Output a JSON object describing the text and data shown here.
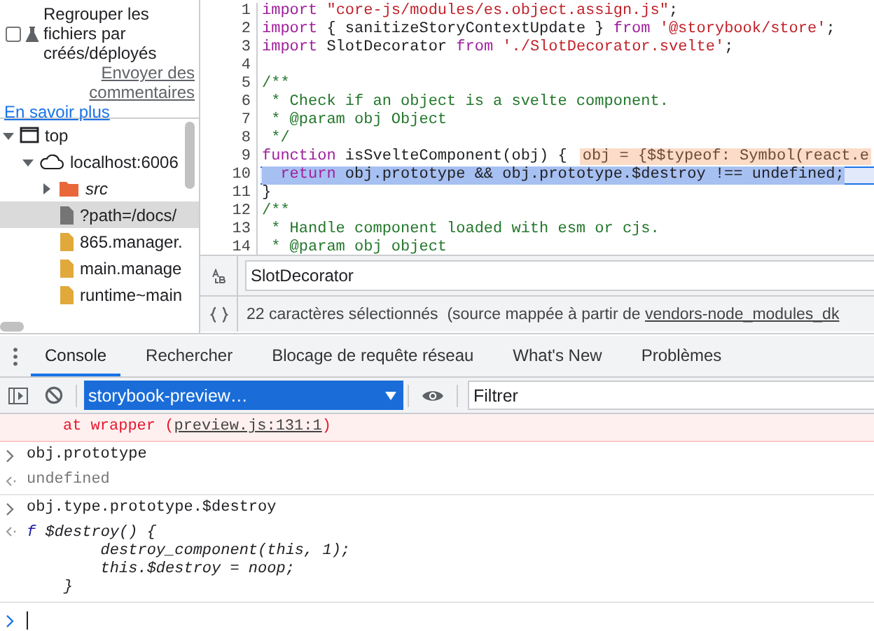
{
  "sidebar": {
    "group_option": {
      "label": "Regrouper les fichiers par créés/déployés",
      "checked": false
    },
    "feedback_link": "Envoyer des commentaires",
    "learn_more_link": "En savoir plus",
    "tree": [
      {
        "label": "top",
        "kind": "frame",
        "expanded": true,
        "selected": false,
        "children": [
          {
            "label": "localhost:6006",
            "kind": "origin",
            "expanded": true,
            "selected": false,
            "children": [
              {
                "label": "src",
                "kind": "folder",
                "expanded": false,
                "selected": false
              },
              {
                "label": "?path=/docs/",
                "kind": "document",
                "selected": true
              },
              {
                "label": "865.manager.",
                "kind": "script",
                "selected": false
              },
              {
                "label": "main.manage",
                "kind": "script",
                "selected": false
              },
              {
                "label": "runtime~main",
                "kind": "script",
                "selected": false
              }
            ]
          }
        ]
      }
    ]
  },
  "editor": {
    "lines": [
      {
        "number": "1",
        "selected": false,
        "tokens": [
          {
            "kind": "keyword",
            "text": "import "
          },
          {
            "kind": "string",
            "text": "\"core-js/modules/es.object.assign.js\""
          },
          {
            "kind": "plain",
            "text": ";"
          }
        ]
      },
      {
        "number": "2",
        "selected": false,
        "tokens": [
          {
            "kind": "keyword",
            "text": "import"
          },
          {
            "kind": "plain",
            "text": " { sanitizeStoryContextUpdate } "
          },
          {
            "kind": "keyword",
            "text": "from "
          },
          {
            "kind": "string",
            "text": "'@storybook/store'"
          },
          {
            "kind": "plain",
            "text": ";"
          }
        ]
      },
      {
        "number": "3",
        "selected": false,
        "tokens": [
          {
            "kind": "keyword",
            "text": "import"
          },
          {
            "kind": "plain",
            "text": " SlotDecorator "
          },
          {
            "kind": "keyword",
            "text": "from "
          },
          {
            "kind": "string",
            "text": "'./SlotDecorator.svelte'"
          },
          {
            "kind": "plain",
            "text": ";"
          }
        ]
      },
      {
        "number": "4",
        "selected": false
      },
      {
        "number": "5",
        "selected": false,
        "tokens": [
          {
            "kind": "comment",
            "text": "/**"
          }
        ]
      },
      {
        "number": "6",
        "selected": false,
        "tokens": [
          {
            "kind": "comment",
            "text": " * Check if an object is a svelte component."
          }
        ]
      },
      {
        "number": "7",
        "selected": false,
        "tokens": [
          {
            "kind": "comment",
            "text": " * @param obj Object"
          }
        ]
      },
      {
        "number": "8",
        "selected": false,
        "tokens": [
          {
            "kind": "comment",
            "text": " */"
          }
        ]
      },
      {
        "number": "9",
        "selected": false,
        "tokens": [
          {
            "kind": "keyword",
            "text": "function"
          },
          {
            "kind": "plain",
            "text": " isSvelteComponent(obj) {"
          }
        ],
        "inline_value": "obj = {$$typeof: Symbol(react.e"
      },
      {
        "number": "10",
        "selected": true,
        "tokens": [
          {
            "kind": "keyword",
            "text": "  return"
          },
          {
            "kind": "plain",
            "text": " obj.prototype && obj.prototype.$destroy !== undefined;"
          }
        ]
      },
      {
        "number": "11",
        "selected": false,
        "tokens": [
          {
            "kind": "plain",
            "text": "}"
          }
        ]
      },
      {
        "number": "12",
        "selected": false,
        "tokens": [
          {
            "kind": "comment",
            "text": "/**"
          }
        ]
      },
      {
        "number": "13",
        "selected": false,
        "tokens": [
          {
            "kind": "comment",
            "text": " * Handle component loaded with esm or cjs."
          }
        ]
      },
      {
        "number": "14",
        "selected": false,
        "tokens": [
          {
            "kind": "comment",
            "text": " * @param obj object"
          }
        ]
      }
    ],
    "search_value": "SlotDecorator",
    "status": {
      "text": "22 caractères sélectionnés  (source mappée à partir de ",
      "link": "vendors-node_modules_dk"
    }
  },
  "drawer": {
    "tabs": [
      {
        "label": "Console",
        "selected": true
      },
      {
        "label": "Rechercher",
        "selected": false
      },
      {
        "label": "Blocage de requête réseau",
        "selected": false
      },
      {
        "label": "What's New",
        "selected": false
      },
      {
        "label": "Problèmes",
        "selected": false
      }
    ],
    "context": "storybook-preview…",
    "filter_placeholder": "Filtrer",
    "entries": [
      {
        "kind": "error",
        "before": "at wrapper (",
        "link": "preview.js:131:1",
        "after": ")"
      },
      {
        "kind": "input",
        "text": "obj.prototype"
      },
      {
        "kind": "undefined",
        "text": "undefined"
      },
      {
        "kind": "input",
        "text": "obj.type.prototype.$destroy"
      },
      {
        "kind": "function",
        "prefix": "f",
        "lines": [
          "$destroy() {",
          "        destroy_component(this, 1);",
          "        this.$destroy = noop;",
          "    }"
        ]
      },
      {
        "kind": "prompt"
      }
    ]
  }
}
